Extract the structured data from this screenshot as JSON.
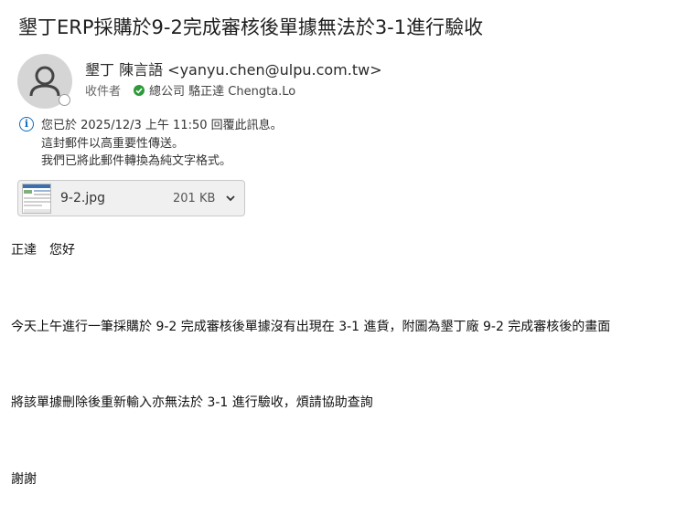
{
  "email": {
    "subject": "墾丁ERP採購於9-2完成審核後單據無法於3-1進行驗收",
    "sender": "墾丁 陳言語 <yanyu.chen@ulpu.com.tw>",
    "to_label": "收件者",
    "to_value": "總公司 駱正達 Chengta.Lo",
    "info_lines": [
      "您已於 2025/12/3 上午 11:50 回覆此訊息。",
      "這封郵件以高重要性傳送。",
      "我們已將此郵件轉換為純文字格式。"
    ],
    "attachment": {
      "name": "9-2.jpg",
      "size": "201 KB"
    },
    "body": [
      "正達　您好",
      "今天上午進行一筆採購於 9-2 完成審核後單據沒有出現在 3-1 進貨，附圖為墾丁廠 9-2 完成審核後的畫面",
      "將該單據刪除後重新輸入亦無法於 3-1 進行驗收，煩請協助查詢",
      "謝謝"
    ]
  },
  "colors": {
    "accent": "#0f6cbd",
    "presence_ok": "#2d9a3a"
  }
}
